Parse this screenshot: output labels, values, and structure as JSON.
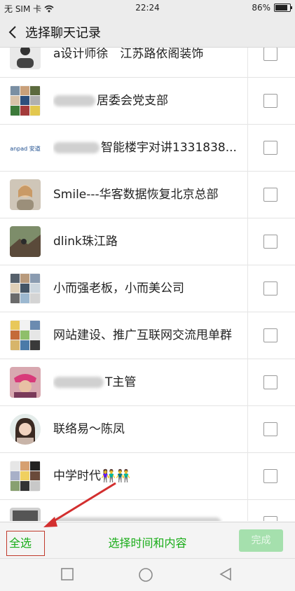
{
  "status_bar": {
    "carrier": "无 SIM 卡",
    "time": "22:24",
    "battery": "86%",
    "battery_level": 0.86
  },
  "header": {
    "title": "选择聊天记录"
  },
  "chats": [
    {
      "name": "a设计师徐　江苏路依阁装饰"
    },
    {
      "name": "居委会党支部"
    },
    {
      "name": "智能楼宇对讲1331838..."
    },
    {
      "name": "Smile---华客数据恢复北京总部"
    },
    {
      "name": "dlink珠江路"
    },
    {
      "name": "小而强老板，小而美公司"
    },
    {
      "name": "网站建设、推广互联网交流甩单群"
    },
    {
      "name": "T主管"
    },
    {
      "name": "联络易～陈凤"
    },
    {
      "name": "中学时代👫👬"
    }
  ],
  "logo_text": "anpad 安道",
  "bottom_bar": {
    "select_all": "全选",
    "select_time_content": "选择时间和内容",
    "confirm": "完成"
  },
  "colors": {
    "accent": "#1aad19",
    "annotation": "#c0392b",
    "bar": "#ececec"
  }
}
